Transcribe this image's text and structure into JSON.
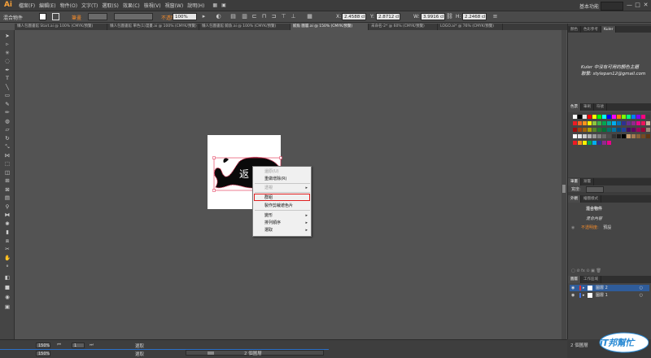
{
  "app": {
    "logo": "Ai"
  },
  "menubar": {
    "items": [
      "檔案(F)",
      "編輯(E)",
      "物件(O)",
      "文字(T)",
      "選取(S)",
      "效果(C)",
      "檢視(V)",
      "視窗(W)",
      "說明(H)"
    ],
    "workspace": "基本功能",
    "window_controls": [
      "—",
      "□",
      "✕"
    ]
  },
  "controlbar": {
    "selection_label": "混合物件",
    "stroke_label": "筆畫",
    "opacity_label": "不透明度",
    "opacity_value": "100%",
    "x_value": "2.4588 cl",
    "y_value": "2.8712 cl",
    "w_value": "3.9916 cl",
    "h_value": "2.2468 cl"
  },
  "tabs": [
    {
      "label": "懶人包圖書館 Start.ai @ 100% (CMYK/預覽)",
      "active": false
    },
    {
      "label": "懶人包圖書館 單色(1)漫畫.ai @ 100% (CMYK/預覽)",
      "active": false
    },
    {
      "label": "懶人包圖書館 鯨魚.ai @ 100% (CMYK/預覽)",
      "active": false
    },
    {
      "label": "鯨魚 圖層.ai @ 150% (CMYK/預覽)",
      "active": true
    },
    {
      "label": "未命名-2* @ 60% (CMYK/預覽)",
      "active": false
    },
    {
      "label": "LOGO.ai* @ 76% (CMYK/預覽)",
      "active": false
    }
  ],
  "artwork": {
    "glyph": "返"
  },
  "context_menu": {
    "undo": "還原(U)",
    "redo": "重做增除(R)",
    "perspective": "透視",
    "group": "群組",
    "make_compound": "製作剪裁遮色片",
    "transform": "變形",
    "arrange": "排列順序",
    "select": "選取"
  },
  "statusbar": {
    "zoom": "150%",
    "page": "1",
    "mode": "選取",
    "layer_count": "2 個圖層"
  },
  "panels": {
    "kuler_tabs": [
      "顏色",
      "色彩參考",
      "Kuler"
    ],
    "kuler_text_1": "Kuler 中沒有可用的顏色主題",
    "kuler_text_2": "聯繫: stylepan12@gmail.com",
    "swatch_tabs": [
      "色票",
      "筆刷",
      "符號"
    ],
    "stroke_tabs": [
      "筆畫",
      "漸層"
    ],
    "appearance_tabs": [
      "外觀",
      "繪圖樣式"
    ],
    "appearance_title": "混合物件",
    "appearance_content": "混合內容",
    "appearance_opacity_label": "不透明度:",
    "appearance_opacity_value": "預設",
    "layers_tabs": [
      "圖層",
      "工作區域"
    ],
    "layers": [
      {
        "name": "圖層 2",
        "color": "#e03030"
      },
      {
        "name": "圖層 1",
        "color": "#3a6ee0"
      }
    ],
    "bottom_label": "2 個圖層"
  },
  "watermark": {
    "text": "iT邦幫忙",
    "sub": "iT邦"
  }
}
